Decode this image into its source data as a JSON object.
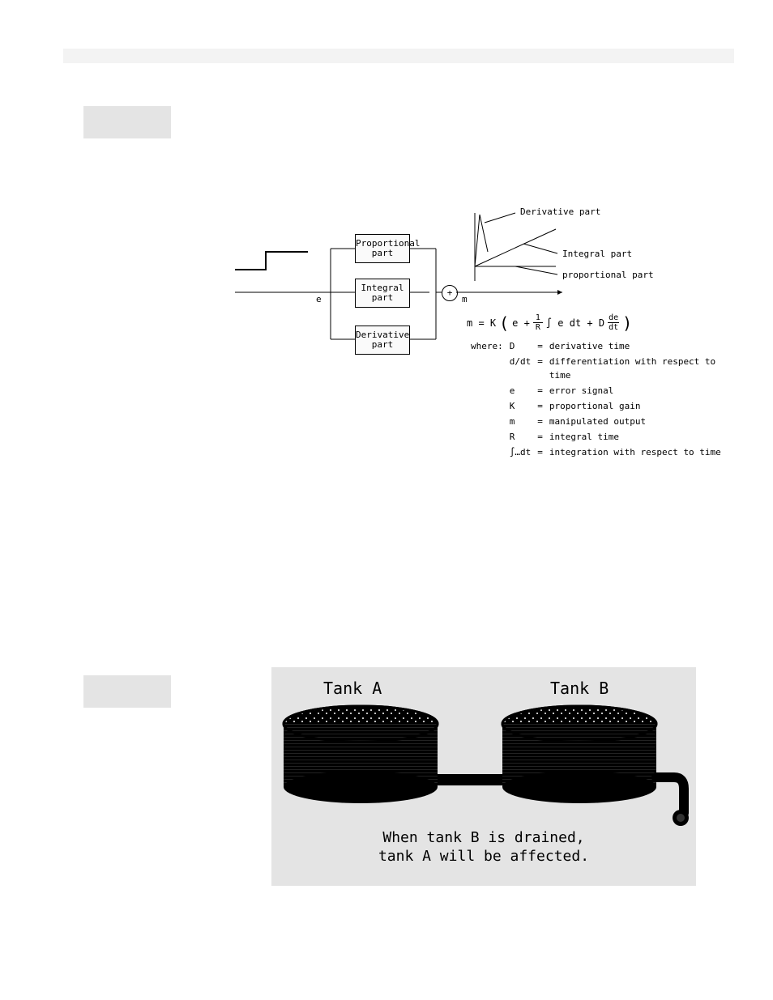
{
  "fig1": {
    "e_label": "e",
    "m_label": "m",
    "prop_box_l1": "Proportional",
    "prop_box_l2": "part",
    "int_box_l1": "Integral",
    "int_box_l2": "part",
    "der_box_l1": "Derivative",
    "der_box_l2": "part",
    "sum_symbol": "+",
    "arrow_deriv": "Derivative part",
    "arrow_int": "Integral part",
    "arrow_prop": "proportional part",
    "equation_prefix": "m  =  K",
    "equation_e": "e  +",
    "equation_frac_num": "1",
    "equation_frac_den": "R",
    "equation_int": "∫ e dt  +  D",
    "equation_de_num": "de",
    "equation_de_den": "dt",
    "where_label": "where:",
    "where_rows": [
      [
        "D",
        "derivative time"
      ],
      [
        "d/dt",
        "differentiation with respect to time"
      ],
      [
        "e",
        "error signal"
      ],
      [
        "K",
        "proportional gain"
      ],
      [
        "m",
        "manipulated output"
      ],
      [
        "R",
        "integral time"
      ],
      [
        "∫…dt",
        "integration with respect to time"
      ]
    ]
  },
  "fig2": {
    "tank_a": "Tank A",
    "tank_b": "Tank B",
    "caption_l1": "When tank B is drained,",
    "caption_l2": "tank A will be affected."
  }
}
